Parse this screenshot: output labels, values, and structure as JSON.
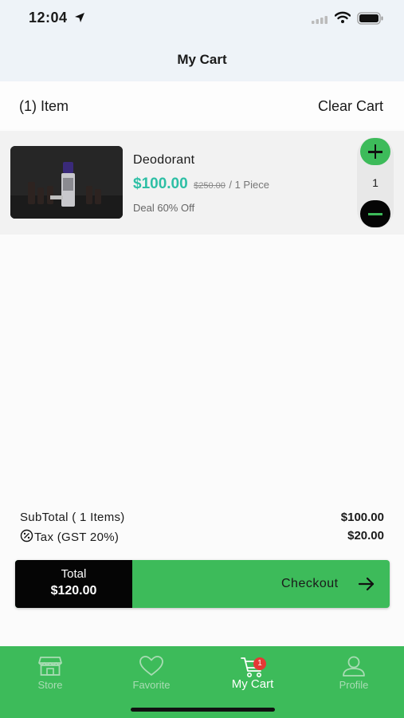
{
  "status_bar": {
    "time": "12:04"
  },
  "header": {
    "title": "My Cart"
  },
  "cart": {
    "item_count_label": "(1) Item",
    "clear_label": "Clear Cart"
  },
  "items": [
    {
      "name": "Deodorant",
      "price": "$100.00",
      "old_price": "$250.00",
      "unit": "/ 1 Piece",
      "deal": "Deal 60% Off",
      "quantity": "1"
    }
  ],
  "summary": {
    "subtotal_label": "SubTotal ( 1 Items)",
    "subtotal_value": "$100.00",
    "tax_label": "Tax (GST 20%)",
    "tax_value": "$20.00"
  },
  "checkout": {
    "total_label": "Total",
    "total_value": "$120.00",
    "button_label": "Checkout"
  },
  "tabs": [
    {
      "label": "Store",
      "icon": "store-icon"
    },
    {
      "label": "Favorite",
      "icon": "heart-icon"
    },
    {
      "label": "My Cart",
      "icon": "cart-icon",
      "active": true,
      "badge": "1"
    },
    {
      "label": "Profile",
      "icon": "user-icon"
    }
  ],
  "colors": {
    "accent": "#3dbb5a",
    "price": "#2ebfa5",
    "dark": "#050505",
    "badge": "#e53935"
  }
}
